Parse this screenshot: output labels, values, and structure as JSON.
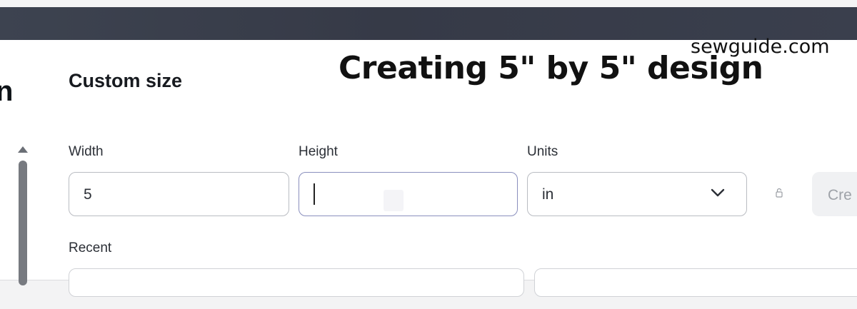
{
  "overlay": {
    "title": "Creating 5\" by 5\" design",
    "watermark": "sewguide.com"
  },
  "left_fragment": "n",
  "dialog": {
    "title": "Custom size",
    "width": {
      "label": "Width",
      "value": "5"
    },
    "height": {
      "label": "Height",
      "value": ""
    },
    "units": {
      "label": "Units",
      "value": "in"
    },
    "create_label": "Cre",
    "recent_label": "Recent"
  },
  "colors": {
    "top_bar": "#3a3f4c",
    "field_border": "#b9bcc2",
    "field_focus_border": "#8a8fbd",
    "create_button_bg": "#f0f1f3",
    "create_button_text": "#9ea2a8"
  },
  "icons": {
    "units_dropdown": "chevron-down-icon",
    "aspect_lock": "lock-icon",
    "scroll_up": "caret-up-icon"
  }
}
